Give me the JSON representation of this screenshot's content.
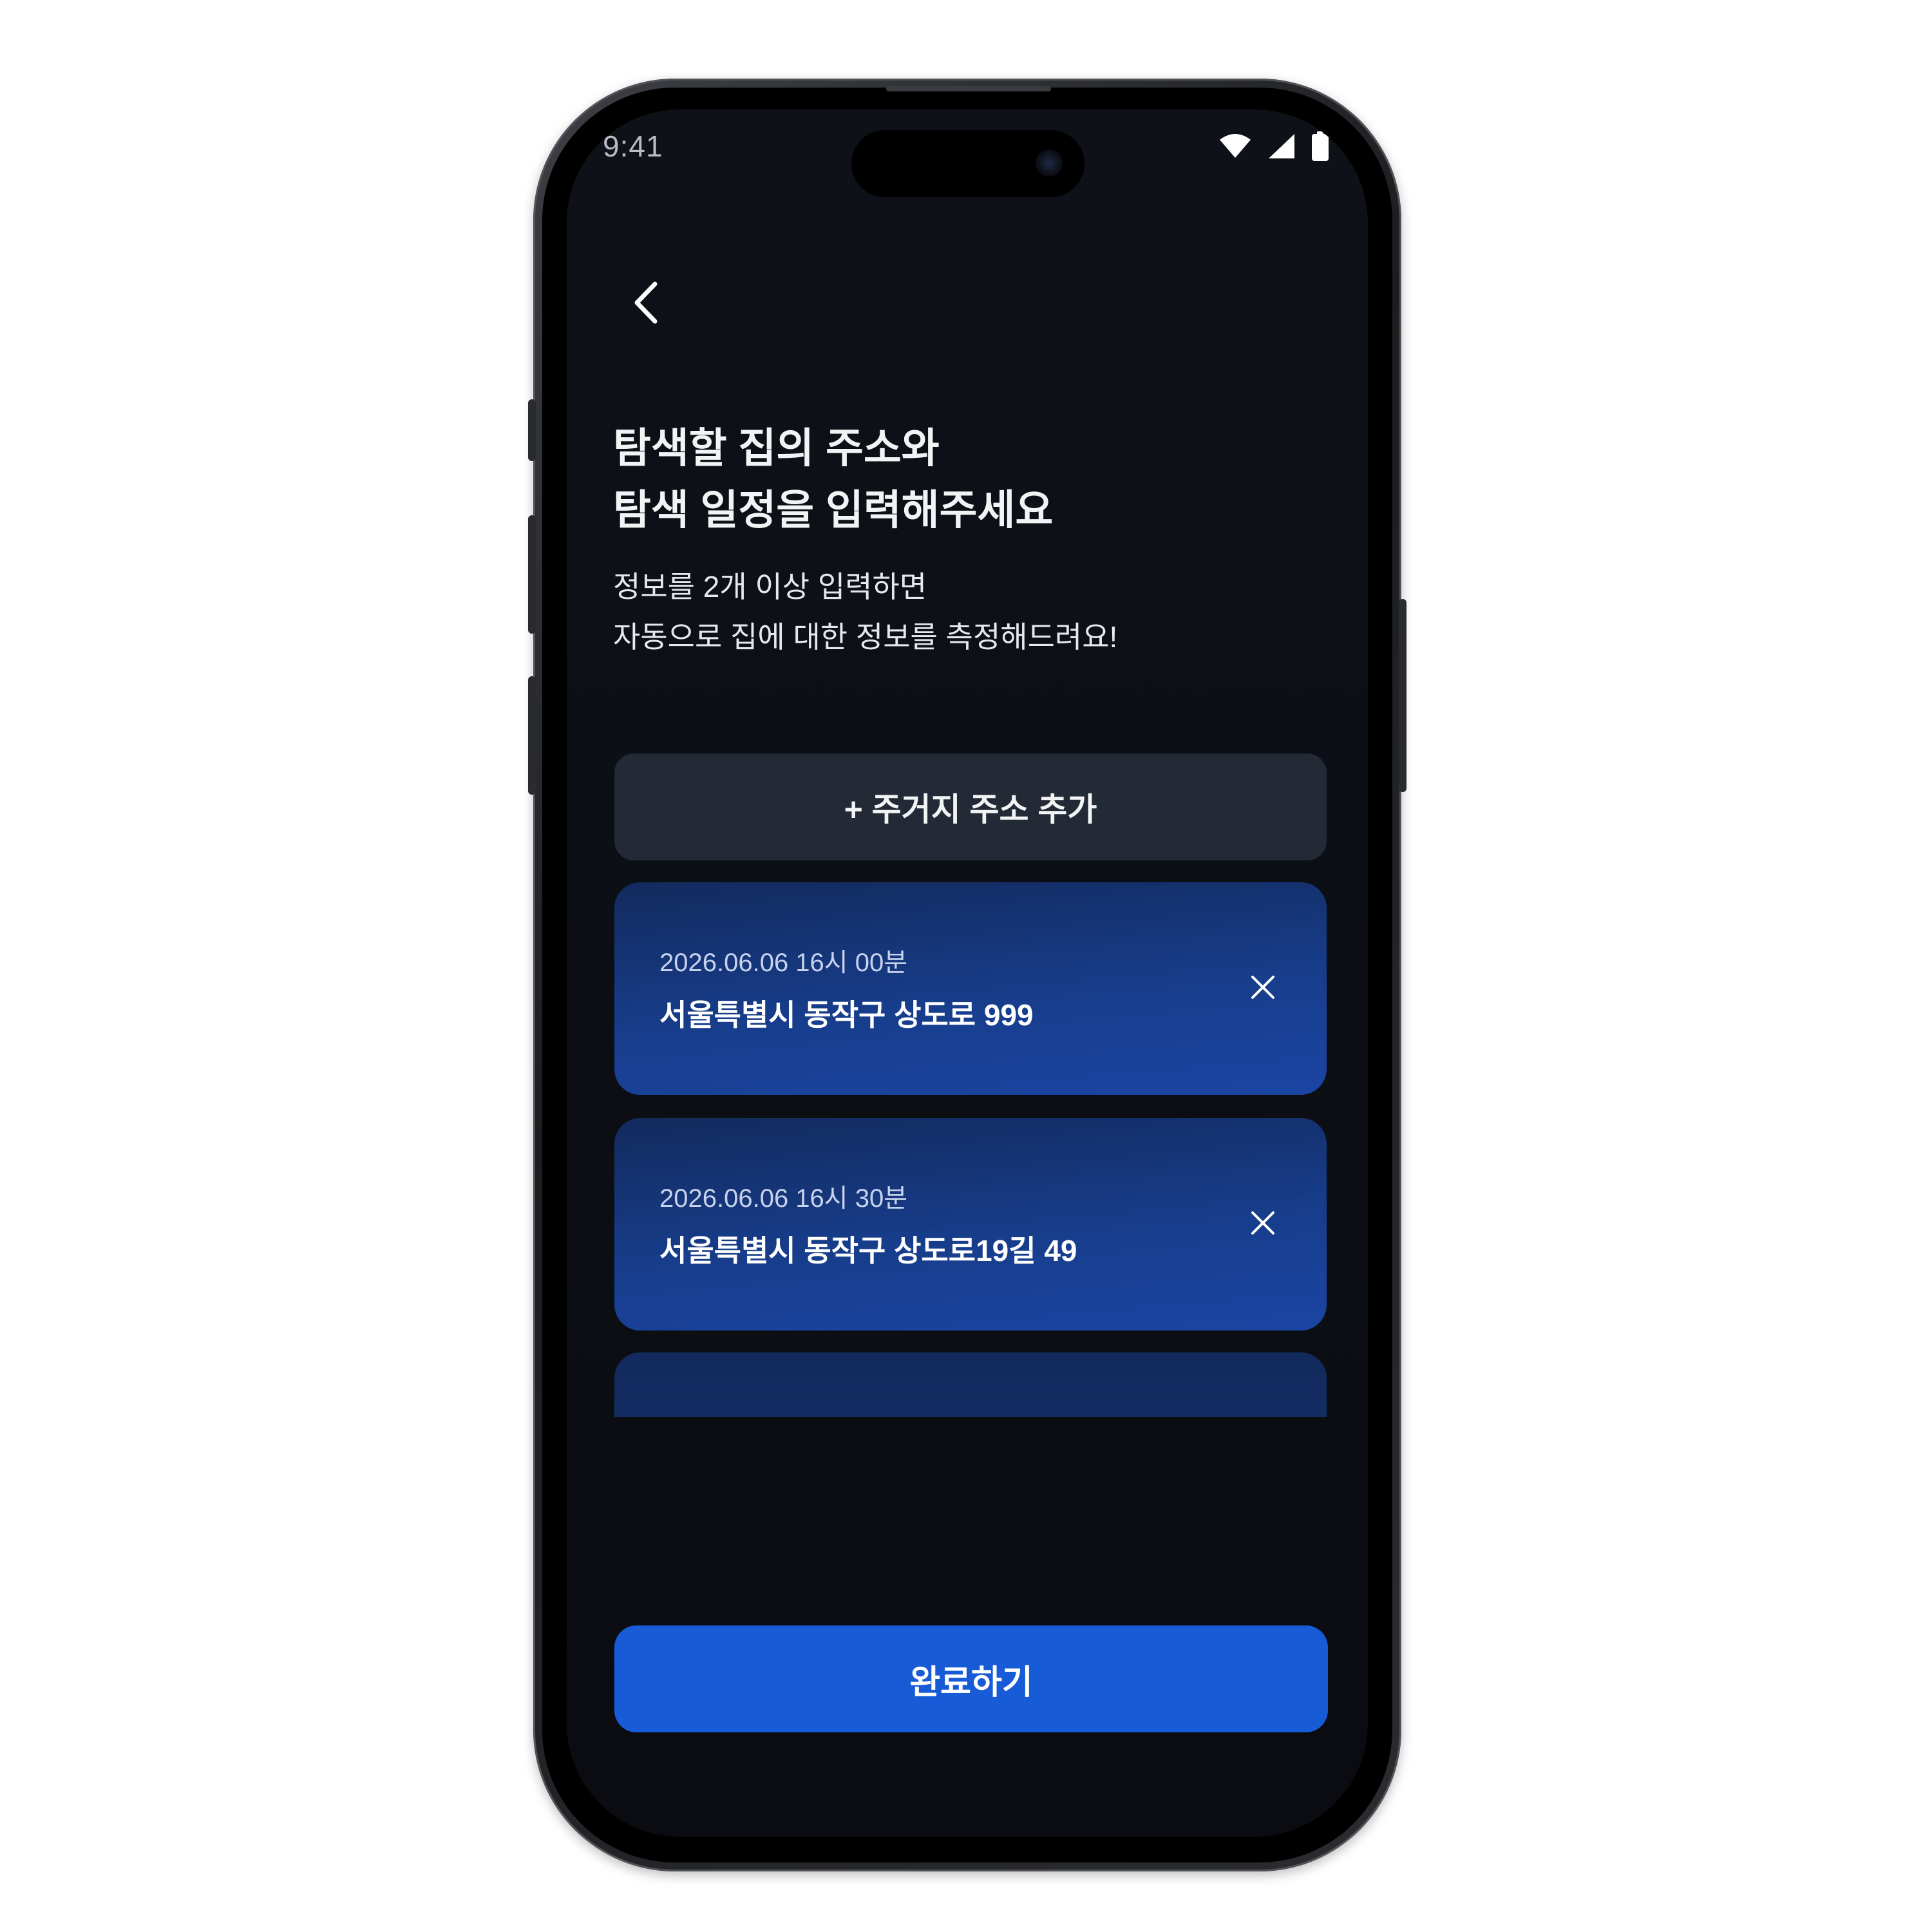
{
  "status_bar": {
    "time": "9:41",
    "icons": [
      "wifi-icon",
      "cellular-signal-icon",
      "battery-icon"
    ]
  },
  "header": {
    "back_icon": "chevron-left-icon"
  },
  "title": {
    "line1": "탐색할 집의 주소와",
    "line2": "탐색 일정을 입력해주세요"
  },
  "subtitle": {
    "line1": "정보를 2개 이상 입력하면",
    "line2": "자동으로 집에 대한 정보를 측정해드려요!"
  },
  "add_address_button": {
    "label": "+ 주거지 주소 추가"
  },
  "visits": [
    {
      "datetime": "2026.06.06 16시 00분",
      "address": "서울특별시 동작구 상도로 999",
      "remove_icon": "close-icon"
    },
    {
      "datetime": "2026.06.06 16시 30분",
      "address": "서울특별시 동작구 상도로19길 49",
      "remove_icon": "close-icon"
    }
  ],
  "complete_button": {
    "label": "완료하기"
  },
  "colors": {
    "screen_background": "#0b0e14",
    "card_gradient_top": "#132a5d",
    "card_gradient_bottom": "#1a45a3",
    "add_button_background": "#232a35",
    "primary_button": "#175bd6",
    "text_primary": "#f2f3f5",
    "text_secondary": "#c7d3ee"
  }
}
